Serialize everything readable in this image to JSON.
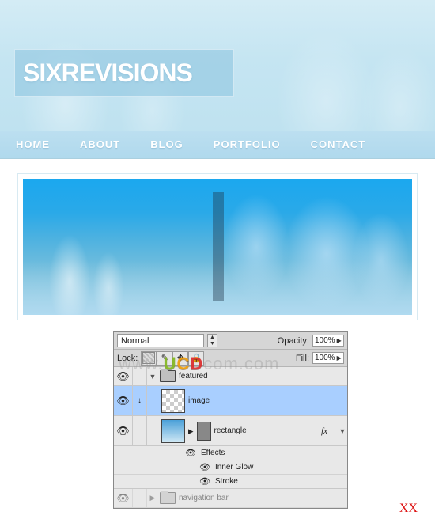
{
  "header": {
    "logo_text": "SIXREVISIONS"
  },
  "nav": {
    "items": [
      "HOME",
      "ABOUT",
      "BLOG",
      "PORTFOLIO",
      "CONTACT"
    ]
  },
  "panel": {
    "blend_mode": "Normal",
    "opacity_label": "Opacity:",
    "opacity_value": "100%",
    "lock_label": "Lock:",
    "fill_label": "Fill:",
    "fill_value": "100%",
    "layers": {
      "group_featured": "featured",
      "layer_image": "image",
      "layer_rectangle": "rectangle",
      "fx_label": "fx",
      "effects_label": "Effects",
      "inner_glow": "Inner Glow",
      "stroke": "Stroke",
      "group_nav": "navigation bar"
    }
  },
  "watermark": {
    "prefix": "www.",
    "u": "U",
    "c": "C",
    "d": "D",
    "suffix": "com.com"
  },
  "corner_mark": "XX"
}
